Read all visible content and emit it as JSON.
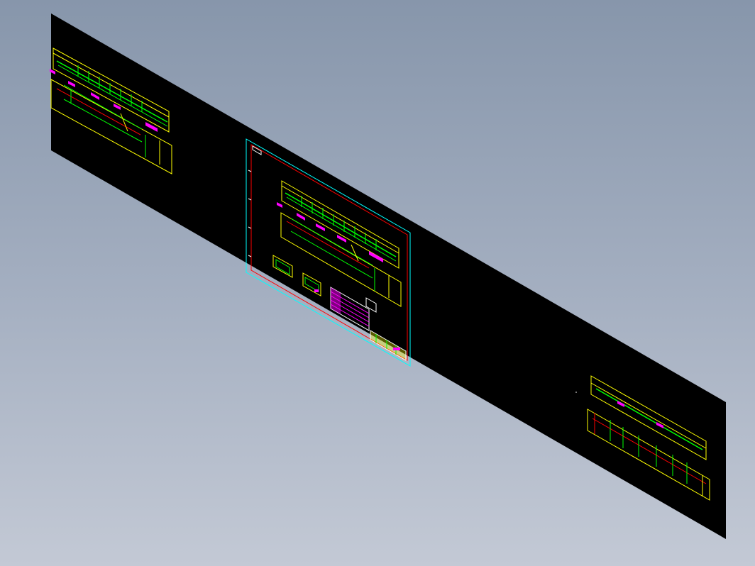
{
  "viewport": {
    "background_top": "#8796ab",
    "background_bottom": "#c3c9d5"
  },
  "sheet": {
    "color": "#000000"
  },
  "drawing_colors": {
    "yellow": "#ffff00",
    "green": "#00ff00",
    "magenta": "#ff00ff",
    "red": "#ff0000",
    "cyan": "#00ffff",
    "white": "#ffffff"
  },
  "views": [
    {
      "name": "left-drawing-view",
      "type": "conveyor-elevation"
    },
    {
      "name": "center-drawing-sheet",
      "type": "titled-sheet-with-tables"
    },
    {
      "name": "right-drawing-view",
      "type": "conveyor-elevation"
    }
  ]
}
